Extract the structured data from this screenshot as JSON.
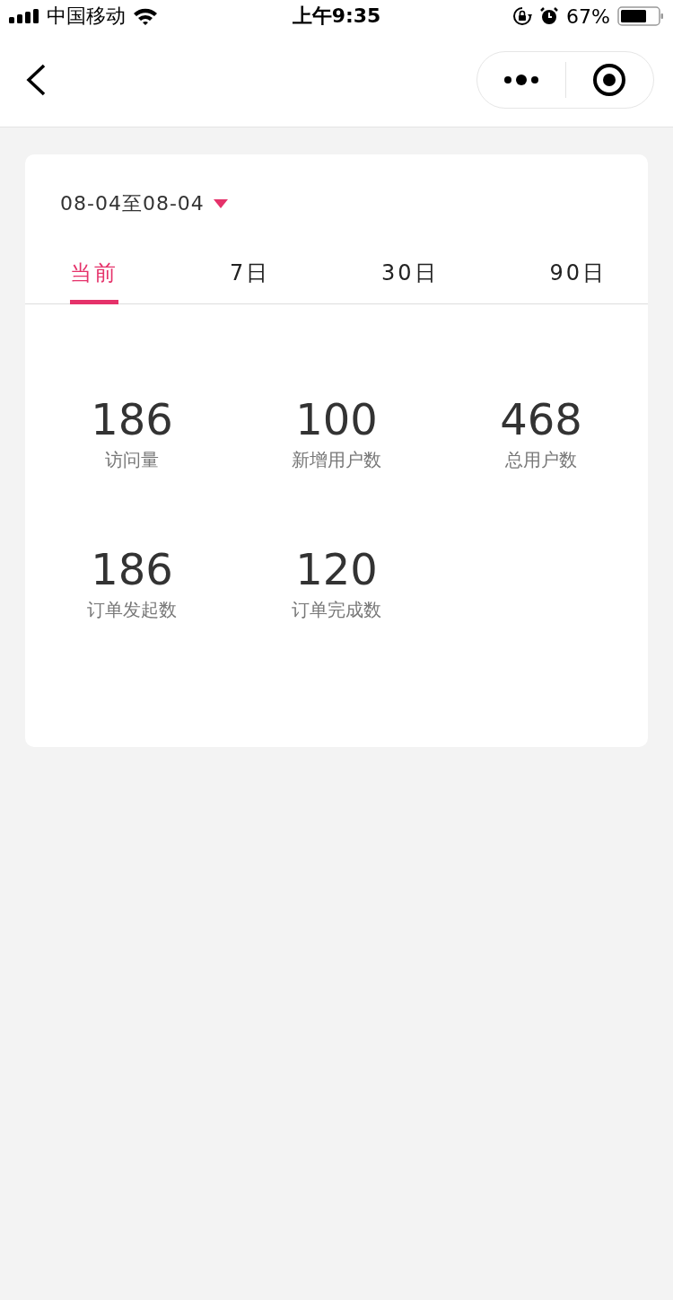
{
  "status_bar": {
    "carrier": "中国移动",
    "time": "上午9:35",
    "battery": "67%"
  },
  "date_range": {
    "label": "08-04至08-04"
  },
  "tabs": [
    {
      "label": "当前",
      "selected": true
    },
    {
      "label": "7日",
      "selected": false
    },
    {
      "label": "30日",
      "selected": false
    },
    {
      "label": "90日",
      "selected": false
    }
  ],
  "stats": [
    {
      "value": "186",
      "label": "访问量"
    },
    {
      "value": "100",
      "label": "新增用户数"
    },
    {
      "value": "468",
      "label": "总用户数"
    },
    {
      "value": "186",
      "label": "订单发起数"
    },
    {
      "value": "120",
      "label": "订单完成数"
    }
  ]
}
